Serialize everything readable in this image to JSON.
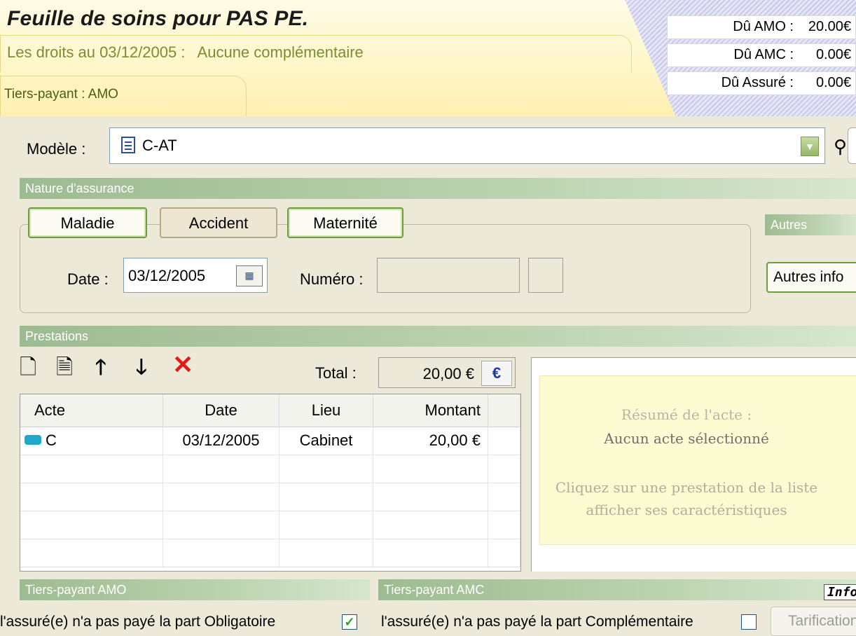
{
  "header": {
    "title": "Feuille de soins pour PAS      PE.",
    "rights_prefix": "Les droits au 03/12/2005 :",
    "rights_value": "Aucune complémentaire",
    "tiers_payant": "Tiers-payant : AMO",
    "dues": [
      {
        "label": "Dû AMO :",
        "value": "20.00€"
      },
      {
        "label": "Dû AMC :",
        "value": "0.00€"
      },
      {
        "label": "Dû Assuré :",
        "value": "0.00€"
      }
    ]
  },
  "modele": {
    "label": "Modèle :",
    "value": "C-AT"
  },
  "nature": {
    "section_title": "Nature d'assurance",
    "buttons": {
      "maladie": "Maladie",
      "accident": "Accident",
      "maternite": "Maternité"
    },
    "date_label": "Date :",
    "date_value": "03/12/2005",
    "numero_label": "Numéro :",
    "numero_value": ""
  },
  "autres": {
    "section_title": "Autres",
    "button": "Autres info"
  },
  "prestations": {
    "section_title": "Prestations",
    "total_label": "Total :",
    "total_value": "20,00 €",
    "euro_symbol": "€",
    "columns": [
      "Acte",
      "Date",
      "Lieu",
      "Montant"
    ],
    "rows": [
      {
        "acte": "C",
        "date": "03/12/2005",
        "lieu": "Cabinet",
        "montant": "20,00 €"
      }
    ]
  },
  "summary": {
    "title": "Résumé de l'acte :",
    "none": "Aucun acte sélectionné",
    "hint_line1": "Cliquez sur une prestation de la liste",
    "hint_line2": "afficher ses caractéristiques"
  },
  "tiers_payant_amo": {
    "section_title": "Tiers-payant AMO",
    "text": "l'assuré(e) n'a pas payé la part Obligatoire",
    "checked": true
  },
  "tiers_payant_amc": {
    "section_title": "Tiers-payant AMC",
    "text": "l'assuré(e) n'a pas payé la part Complémentaire",
    "checked": false
  },
  "tarification_button": "Tarification",
  "info_tag": "Info",
  "colors": {
    "accent_green": "#6f9a3e",
    "section_bar": "#9dbb90",
    "header_bg": "#fff6c8"
  }
}
